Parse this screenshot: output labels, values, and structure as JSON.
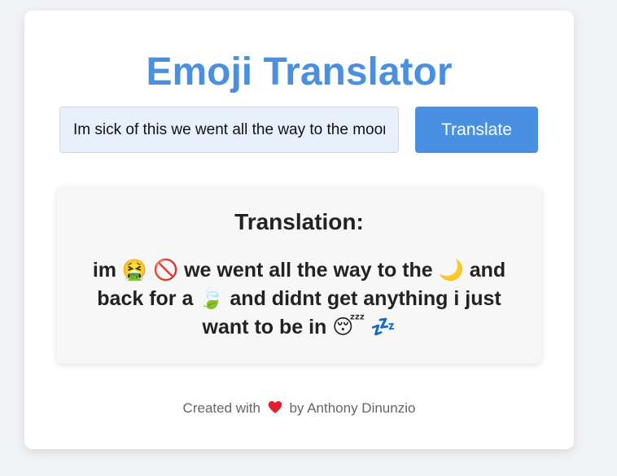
{
  "app": {
    "title": "Emoji Translator",
    "title_color": "#4a90e2"
  },
  "form": {
    "input_value": "Im sick of this we went all the way to the moon and back for a leaf and didnt get anything i just want to be in bed",
    "input_bg": "#e8f0fe",
    "button_label": "Translate",
    "button_color": "#4a90e2"
  },
  "result": {
    "heading": "Translation:",
    "text": "im 🤮 🚫 we went all the way to the 🌙 and back for a 🍃 and didnt get anything i just want to be in 😴 💤"
  },
  "footer": {
    "prefix": "Created with",
    "heart_icon": "red-heart",
    "heart_color": "#e0202e",
    "suffix": "by Anthony Dinunzio"
  }
}
